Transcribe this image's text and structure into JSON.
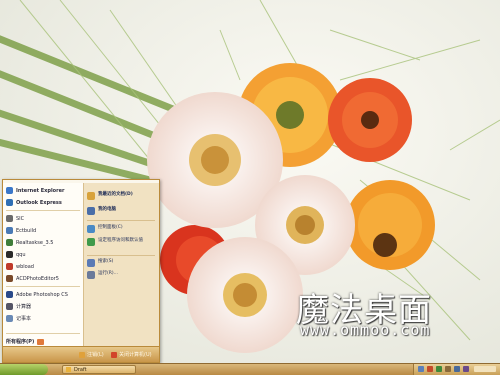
{
  "start_menu": {
    "pinned": [
      {
        "label": "Internet Explorer",
        "icon": "internet-explorer-icon",
        "color": "#3b78c9"
      },
      {
        "label": "Outlook Express",
        "icon": "outlook-express-icon",
        "color": "#2f6fb5"
      }
    ],
    "recent": [
      {
        "label": "SIC",
        "icon": "app-icon",
        "color": "#6a6a6a"
      },
      {
        "label": "Ectbuild",
        "icon": "build-icon",
        "color": "#4a7ab5"
      },
      {
        "label": "Realtaskse_3.5",
        "icon": "task-icon",
        "color": "#3f7d3a"
      },
      {
        "label": "qqu",
        "icon": "qq-icon",
        "color": "#2a2a2a"
      },
      {
        "label": "wbload",
        "icon": "download-icon",
        "color": "#c03a2a"
      },
      {
        "label": "ACDPhotoEditor5",
        "icon": "photo-editor-icon",
        "color": "#7a4a2a"
      },
      {
        "label": "Adobe Photoshop CS",
        "icon": "photoshop-icon",
        "color": "#2a4a8a"
      },
      {
        "label": "计算器",
        "icon": "calculator-icon",
        "color": "#555566"
      },
      {
        "label": "记事本",
        "icon": "notepad-icon",
        "color": "#6a8ab5"
      }
    ],
    "all_programs_label": "所有程序(P)",
    "right_items": [
      {
        "label": "我最近的文档(D)",
        "icon": "recent-docs-icon",
        "color": "#d8a23a"
      },
      {
        "label": "我的电脑",
        "icon": "my-computer-icon",
        "color": "#4a6ea8"
      },
      {
        "label": "控制面板(C)",
        "icon": "control-panel-icon",
        "color": "#4a8ac5"
      },
      {
        "label": "设定程序访问和默认值",
        "icon": "program-defaults-icon",
        "color": "#3f9a4a"
      },
      {
        "label": "搜索(S)",
        "icon": "search-icon",
        "color": "#5a7ab5"
      },
      {
        "label": "运行(R)...",
        "icon": "run-icon",
        "color": "#6a7a9a"
      }
    ],
    "footer": {
      "logoff_label": "注销(L)",
      "shutdown_label": "关闭计算机(U)",
      "logoff_color": "#e0a13a",
      "shutdown_color": "#d2452a"
    }
  },
  "taskbar": {
    "item_label": "Draft",
    "start_color": "#7fa53a"
  },
  "watermark": {
    "logo_text": "魔法桌面",
    "site_text": "www.ommoo.com"
  }
}
